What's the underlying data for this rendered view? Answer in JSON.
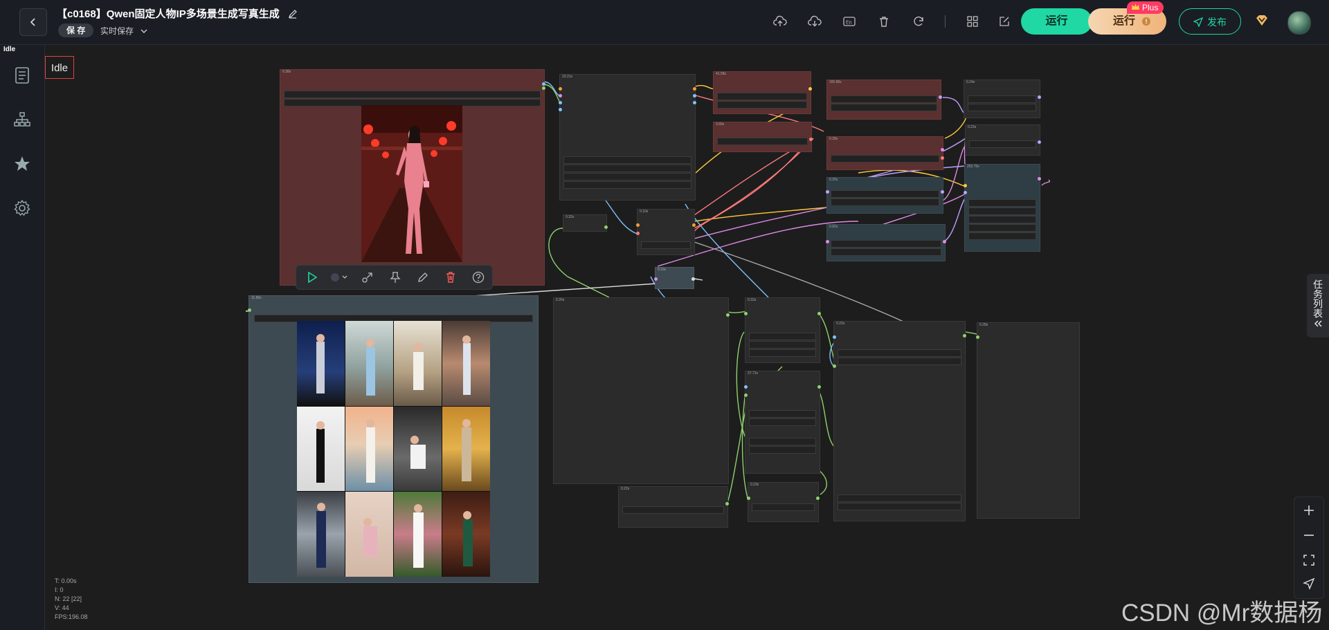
{
  "header": {
    "title": "【c0168】Qwen固定人物IP多场景生成写真生成",
    "save_label": "保 存",
    "autosave_label": "实时保存",
    "run_label": "运行",
    "run_plus_label": "运行",
    "plus_badge": "Plus",
    "publish_label": "发布"
  },
  "status": {
    "tiny_idle": "Idle",
    "idle_label": "Idle"
  },
  "sidebar": {
    "items": [
      {
        "name": "workflow-list",
        "icon": "document-icon"
      },
      {
        "name": "node-tree",
        "icon": "sitemap-icon"
      },
      {
        "name": "favorites",
        "icon": "star-icon"
      },
      {
        "name": "settings",
        "icon": "gear-icon"
      }
    ]
  },
  "node_timings": [
    "0.38s",
    "23.21s",
    "41.58s",
    "0.66s",
    "165.80s",
    "0.28s",
    "0.25s",
    "0.16s",
    "0.24s",
    "0.22s",
    "0.32s",
    "0.10s",
    "0.26s",
    "0.22s",
    "0.32s",
    "27.71s",
    "0.22s",
    "0.23s",
    "0.28s",
    "11.86s",
    "202.75s",
    "0.92s"
  ],
  "stats": {
    "t": "T: 0.00s",
    "i": "I: 0",
    "n": "N: 22 [22]",
    "v": "V: 44",
    "fps": "FPS:196.08"
  },
  "right_panel": {
    "task_list_label": "任务列表"
  },
  "watermark": "CSDN @Mr数据杨",
  "colors": {
    "accent": "#1fd8a4",
    "plus": "#ff3b63",
    "node_red": "#5a3030",
    "node_blue": "#2f3d44"
  }
}
